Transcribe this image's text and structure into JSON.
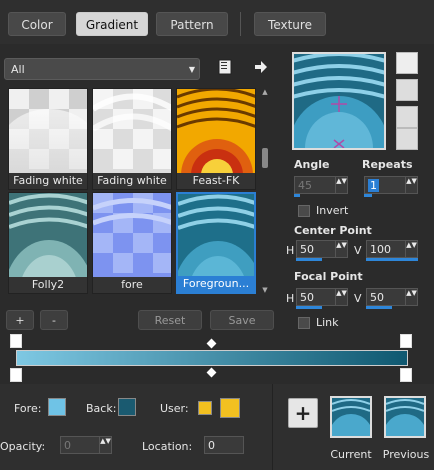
{
  "tabs": [
    {
      "label": "Color",
      "active": false
    },
    {
      "label": "Gradient",
      "active": true
    },
    {
      "label": "Pattern",
      "active": false
    },
    {
      "label": "Texture",
      "active": false
    }
  ],
  "category": {
    "value": "All"
  },
  "thumbnails": [
    {
      "label": "Fading white"
    },
    {
      "label": "Fading white"
    },
    {
      "label": "Feast-FK"
    },
    {
      "label": "Folly2"
    },
    {
      "label": "fore"
    },
    {
      "label": "Foregroun...",
      "selected": true
    }
  ],
  "buttons": {
    "add": "+",
    "remove": "-",
    "reset": "Reset",
    "save": "Save"
  },
  "angle": {
    "label": "Angle",
    "value": "45"
  },
  "repeats": {
    "label": "Repeats",
    "value": "1"
  },
  "invert": {
    "label": "Invert",
    "checked": false
  },
  "center_point": {
    "label": "Center Point",
    "h_label": "H",
    "h_value": "50",
    "v_label": "V",
    "v_value": "100"
  },
  "focal_point": {
    "label": "Focal Point",
    "h_label": "H",
    "h_value": "50",
    "v_label": "V",
    "v_value": "50"
  },
  "link": {
    "label": "Link",
    "checked": false
  },
  "bottom": {
    "fore_label": "Fore:",
    "back_label": "Back:",
    "user_label": "User:",
    "opacity_label": "Opacity:",
    "opacity_value": "0",
    "location_label": "Location:",
    "location_value": "0",
    "current_label": "Current",
    "previous_label": "Previous",
    "add_symbol": "+"
  },
  "colors": {
    "accent": "#2b7fd4",
    "gradient_start": "#7ec8e3",
    "gradient_end": "#0f5870",
    "user_color": "#f2c020",
    "fore_swatch": "#6fc3e6",
    "back_swatch": "#1a5a70"
  },
  "icons": [
    "book-icon",
    "arrow-right-icon",
    "marker-icon",
    "plus-icon"
  ]
}
